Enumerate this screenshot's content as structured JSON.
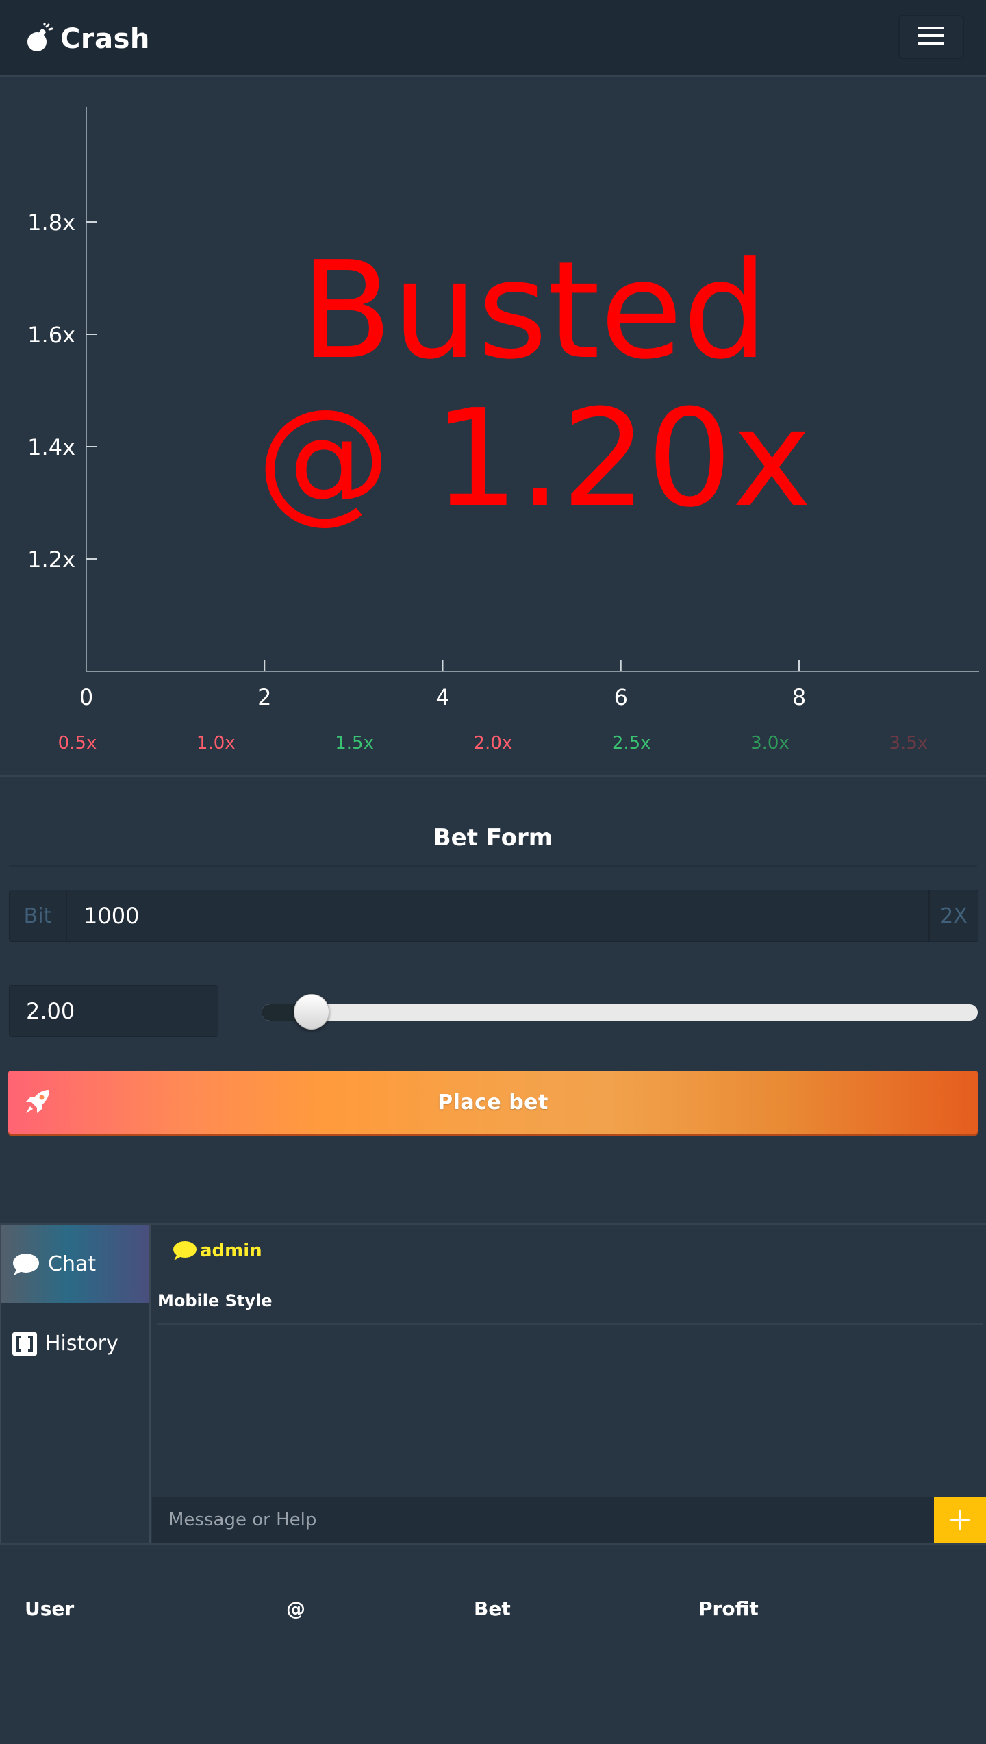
{
  "navbar": {
    "brand": "Crash",
    "brand_icon": "bomb-icon",
    "menu_icon": "hamburger-menu-icon"
  },
  "chart_data": {
    "type": "line",
    "x_ticks": [
      0,
      2,
      4,
      6,
      8
    ],
    "y_ticks": [
      "1.8x",
      "1.6x",
      "1.4x",
      "1.2x"
    ],
    "xlim": [
      0,
      10
    ],
    "ylim": [
      1.0,
      2.0
    ],
    "status_line1": "Busted",
    "status_line2": "@ 1.20x",
    "status_color": "#ff0000",
    "legend": [
      {
        "label": "0.5x",
        "color": "#ff5d6c"
      },
      {
        "label": "1.0x",
        "color": "#ff5d6c"
      },
      {
        "label": "1.5x",
        "color": "#39c271"
      },
      {
        "label": "2.0x",
        "color": "#ff5d6c"
      },
      {
        "label": "2.5x",
        "color": "#39c271"
      },
      {
        "label": "3.0x",
        "color": "#2f9a5a"
      },
      {
        "label": "3.5x",
        "color": "#6b3a44"
      }
    ]
  },
  "bet_form": {
    "title": "Bet Form",
    "currency": "Bit",
    "amount": "1000",
    "double_label": "2X",
    "multiplier": "2.00",
    "slider_fraction": 0.07,
    "place_bet": "Place bet",
    "place_bet_icon": "rocket-icon"
  },
  "tabs": [
    {
      "label": "Chat",
      "icon": "chat-bubble-icon"
    },
    {
      "label": "History",
      "icon": "bracket-icon"
    }
  ],
  "chat": {
    "messages": [
      {
        "user": "admin",
        "text": "Mobile Style"
      }
    ],
    "placeholder": "Message or Help",
    "send_icon": "plus-icon",
    "user_color": "#ffed2b"
  },
  "table": {
    "headers": [
      "User",
      "@",
      "Bet",
      "Profit"
    ]
  }
}
